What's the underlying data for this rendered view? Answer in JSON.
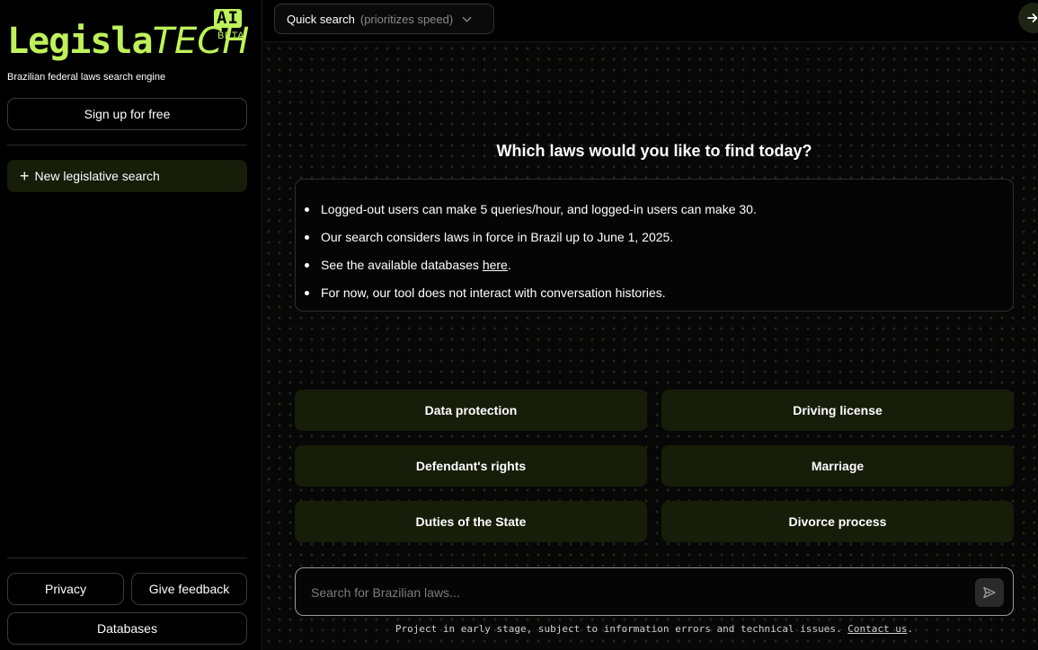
{
  "brand": {
    "name_bold": "Legisla",
    "name_light": "TECH",
    "ai_badge": "AI",
    "beta": "BETA",
    "tagline": "Brazilian federal laws search engine"
  },
  "sidebar": {
    "signup_label": "Sign up for free",
    "new_search_label": "New legislative search",
    "privacy_label": "Privacy",
    "feedback_label": "Give feedback",
    "databases_label": "Databases"
  },
  "topbar": {
    "mode_label": "Quick search",
    "mode_hint": "(prioritizes speed)"
  },
  "main": {
    "heading": "Which laws would you like to find today?",
    "info": {
      "item1": "Logged-out users can make 5 queries/hour, and logged-in users can make 30.",
      "item2": "Our search considers laws in force in Brazil up to June 1, 2025.",
      "item3_prefix": "See the available databases ",
      "item3_link": "here",
      "item3_suffix": ".",
      "item4": "For now, our tool does not interact with conversation histories."
    },
    "suggestions": [
      "Data protection",
      "Driving license",
      "Defendant's rights",
      "Marriage",
      "Duties of the State",
      "Divorce process"
    ],
    "search_placeholder": "Search for Brazilian laws...",
    "footer_text": "Project in early stage, subject to information errors and technical issues. ",
    "footer_link": "Contact us",
    "footer_suffix": "."
  },
  "colors": {
    "accent": "#bff25a",
    "button_dark_green": "#161d09"
  }
}
